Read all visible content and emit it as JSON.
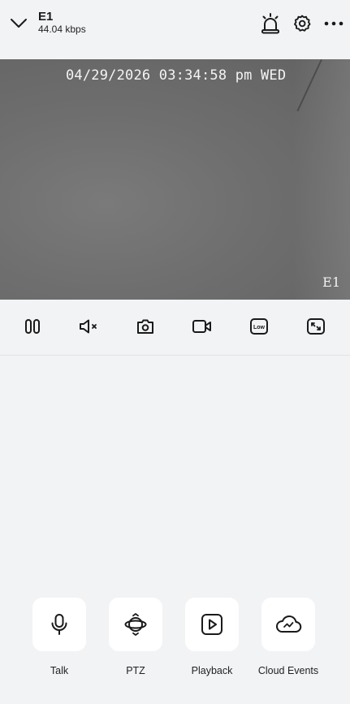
{
  "header": {
    "device_name": "E1",
    "bitrate": "44.04 kbps",
    "icons": [
      "chevron-down-icon",
      "alarm-siren-icon",
      "gear-icon",
      "more-icon"
    ]
  },
  "video": {
    "timestamp": "04/29/2026 03:34:58 pm WED",
    "channel_name": "E1"
  },
  "controls": {
    "icons": [
      "pause-icon",
      "mute-icon",
      "snapshot-icon",
      "record-icon",
      "quality-low-icon",
      "fullscreen-icon"
    ],
    "quality_label": "Low"
  },
  "actions": [
    {
      "label": "Talk",
      "icon": "microphone-icon"
    },
    {
      "label": "PTZ",
      "icon": "ptz-icon"
    },
    {
      "label": "Playback",
      "icon": "playback-icon"
    },
    {
      "label": "Cloud Events",
      "icon": "cloud-icon"
    }
  ],
  "colors": {
    "background": "#f2f3f5",
    "tile": "#ffffff",
    "icon": "#1a1a1a"
  }
}
